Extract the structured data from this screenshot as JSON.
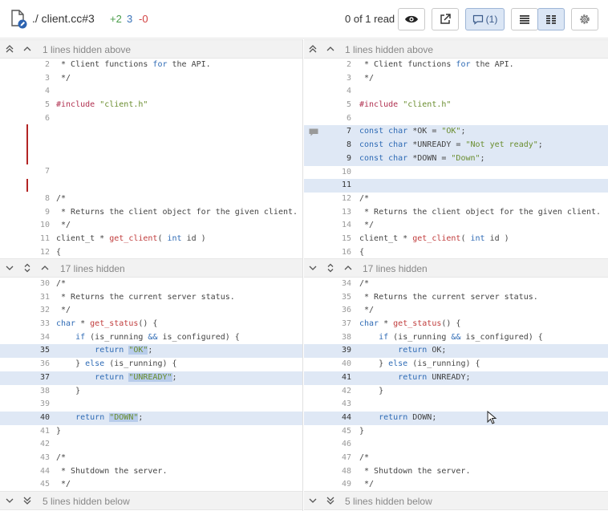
{
  "header": {
    "file_name": "./ client.cc#3",
    "added": "+2",
    "modified": "3",
    "removed": "-0",
    "read_status": "0 of 1 read",
    "comment_count": "(1)"
  },
  "left": {
    "bar_top": "1 lines hidden above",
    "bar_mid": "17 lines hidden",
    "bar_bottom": "5 lines hidden below",
    "block1": [
      {
        "n": "2",
        "t": " * Client functions for the API."
      },
      {
        "n": "3",
        "t": " */"
      },
      {
        "n": "4",
        "t": ""
      },
      {
        "n": "5",
        "t": "#include \"client.h\""
      },
      {
        "n": "6",
        "t": ""
      },
      {
        "n": "7",
        "t": ""
      },
      {
        "n": "8",
        "t": "/*"
      },
      {
        "n": "9",
        "t": " * Returns the client object for the given client."
      },
      {
        "n": "10",
        "t": " */"
      },
      {
        "n": "11",
        "t": "client_t * get_client( int id )"
      },
      {
        "n": "12",
        "t": "{"
      }
    ],
    "block2": [
      {
        "n": "30",
        "t": "/*"
      },
      {
        "n": "31",
        "t": " * Returns the current server status."
      },
      {
        "n": "32",
        "t": " */"
      },
      {
        "n": "33",
        "t": "char * get_status() {"
      },
      {
        "n": "34",
        "t": "    if (is_running && is_configured) {"
      },
      {
        "n": "35",
        "t": "        return \"OK\";"
      },
      {
        "n": "36",
        "t": "    } else (is_running) {"
      },
      {
        "n": "37",
        "t": "        return \"UNREADY\";"
      },
      {
        "n": "38",
        "t": "    }"
      },
      {
        "n": "39",
        "t": ""
      },
      {
        "n": "40",
        "t": "    return \"DOWN\";"
      },
      {
        "n": "41",
        "t": "}"
      },
      {
        "n": "42",
        "t": ""
      },
      {
        "n": "43",
        "t": "/*"
      },
      {
        "n": "44",
        "t": " * Shutdown the server."
      },
      {
        "n": "45",
        "t": " */"
      }
    ]
  },
  "right": {
    "bar_top": "1 lines hidden above",
    "bar_mid": "17 lines hidden",
    "bar_bottom": "5 lines hidden below",
    "block1": [
      {
        "n": "2",
        "t": " * Client functions for the API."
      },
      {
        "n": "3",
        "t": " */"
      },
      {
        "n": "4",
        "t": ""
      },
      {
        "n": "5",
        "t": "#include \"client.h\""
      },
      {
        "n": "6",
        "t": ""
      },
      {
        "n": "7",
        "t": "const char *OK = \"OK\";"
      },
      {
        "n": "8",
        "t": "const char *UNREADY = \"Not yet ready\";"
      },
      {
        "n": "9",
        "t": "const char *DOWN = \"Down\";"
      },
      {
        "n": "10",
        "t": ""
      },
      {
        "n": "11",
        "t": ""
      },
      {
        "n": "12",
        "t": "/*"
      },
      {
        "n": "13",
        "t": " * Returns the client object for the given client."
      },
      {
        "n": "14",
        "t": " */"
      },
      {
        "n": "15",
        "t": "client_t * get_client( int id )"
      },
      {
        "n": "16",
        "t": "{"
      }
    ],
    "block2": [
      {
        "n": "34",
        "t": "/*"
      },
      {
        "n": "35",
        "t": " * Returns the current server status."
      },
      {
        "n": "36",
        "t": " */"
      },
      {
        "n": "37",
        "t": "char * get_status() {"
      },
      {
        "n": "38",
        "t": "    if (is_running && is_configured) {"
      },
      {
        "n": "39",
        "t": "        return OK;"
      },
      {
        "n": "40",
        "t": "    } else (is_running) {"
      },
      {
        "n": "41",
        "t": "        return UNREADY;"
      },
      {
        "n": "42",
        "t": "    }"
      },
      {
        "n": "43",
        "t": ""
      },
      {
        "n": "44",
        "t": "    return DOWN;"
      },
      {
        "n": "45",
        "t": "}"
      },
      {
        "n": "46",
        "t": ""
      },
      {
        "n": "47",
        "t": "/*"
      },
      {
        "n": "48",
        "t": " * Shutdown the server."
      },
      {
        "n": "49",
        "t": " */"
      }
    ]
  },
  "colors": {
    "added": "#4a9d4a",
    "modified": "#3a73b8",
    "removed": "#d24040",
    "highlight": "#dfe8f5",
    "deletion_bar": "#b32424"
  }
}
